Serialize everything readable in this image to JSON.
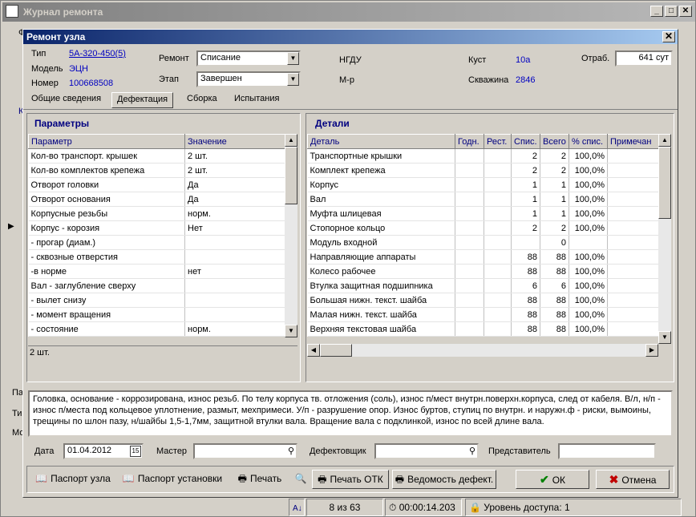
{
  "app": {
    "title": "Журнал ремонта",
    "left_fragments": [
      "Ф",
      "К",
      "Па",
      "Ти",
      "Мо"
    ]
  },
  "dialog": {
    "title": "Ремонт узла",
    "close": "✕",
    "header": {
      "type_label": "Тип",
      "type_value": "5А-320-450(5)",
      "model_label": "Модель",
      "model_value": "ЭЦН",
      "number_label": "Номер",
      "number_value": "100668508",
      "repair_label": "Ремонт",
      "repair_value": "Списание",
      "stage_label": "Этап",
      "stage_value": "Завершен",
      "ngdu_label": "НГДУ",
      "mr_label": "М-р",
      "kust_label": "Куст",
      "kust_value": "10а",
      "well_label": "Скважина",
      "well_value": "2846",
      "otrab_label": "Отраб.",
      "otrab_value": "641 сут"
    },
    "tabs": [
      "Общие сведения",
      "Дефектация",
      "Сборка",
      "Испытания"
    ],
    "params": {
      "title": "Параметры",
      "columns": [
        "Параметр",
        "Значение"
      ],
      "rows": [
        [
          "Кол-во транспорт. крышек",
          "2 шт."
        ],
        [
          "Кол-во комплектов крепежа",
          "2 шт."
        ],
        [
          "Отворот головки",
          "Да"
        ],
        [
          "Отворот основания",
          "Да"
        ],
        [
          "Корпусные резьбы",
          "норм."
        ],
        [
          "Корпус - корозия",
          "Нет"
        ],
        [
          "             - прогар (диам.)",
          ""
        ],
        [
          "             - сквозные отверстия",
          ""
        ],
        [
          "             -в норме",
          "нет"
        ],
        [
          "Вал     - заглубление сверху",
          ""
        ],
        [
          "             - вылет снизу",
          ""
        ],
        [
          "             - момент вращения",
          ""
        ],
        [
          "             - состояние",
          "норм."
        ]
      ],
      "footer": "2 шт."
    },
    "details": {
      "title": "Детали",
      "columns": [
        "Деталь",
        "Годн.",
        "Рест.",
        "Спис.",
        "Всего",
        "% спис.",
        "Примечан"
      ],
      "rows": [
        [
          "Транспортные крышки",
          "",
          "",
          "2",
          "2",
          "100,0%",
          ""
        ],
        [
          "Комплект крепежа",
          "",
          "",
          "2",
          "2",
          "100,0%",
          ""
        ],
        [
          "Корпус",
          "",
          "",
          "1",
          "1",
          "100,0%",
          ""
        ],
        [
          "Вал",
          "",
          "",
          "1",
          "1",
          "100,0%",
          ""
        ],
        [
          "Муфта шлицевая",
          "",
          "",
          "1",
          "1",
          "100,0%",
          ""
        ],
        [
          "Стопорное кольцо",
          "",
          "",
          "2",
          "2",
          "100,0%",
          ""
        ],
        [
          "Модуль входной",
          "",
          "",
          "",
          "0",
          "",
          ""
        ],
        [
          "Направляющие аппараты",
          "",
          "",
          "88",
          "88",
          "100,0%",
          ""
        ],
        [
          "Колесо рабочее",
          "",
          "",
          "88",
          "88",
          "100,0%",
          ""
        ],
        [
          "Втулка защитная подшипника",
          "",
          "",
          "6",
          "6",
          "100,0%",
          ""
        ],
        [
          "Большая нижн. текст. шайба",
          "",
          "",
          "88",
          "88",
          "100,0%",
          ""
        ],
        [
          "Малая нижн. текст. шайба",
          "",
          "",
          "88",
          "88",
          "100,0%",
          ""
        ],
        [
          "Верхняя текстовая шайба",
          "",
          "",
          "88",
          "88",
          "100,0%",
          ""
        ]
      ]
    },
    "notes": "Головка, основание - коррозирована, износ резьб. По телу корпуса тв. отложения (соль), износ п/мест внутрн.поверхн.корпуса, след от кабеля. В/л, н/п - износ п/места под кольцевое уплотнение, размыт, мехпримеси. У/п - разрушение опор. Износ буртов, ступиц по внутрн. и наружн.ф - риски, вымоины, трещины по шлон пазу, н/шайбы 1,5-1,7мм, защитной втулки вала. Вращение вала с подклинкой, износ по всей длине вала.",
    "bottom": {
      "date_label": "Дата",
      "date_value": "01.04.2012",
      "master_label": "Мастер",
      "master_value": "",
      "defect_label": "Дефектовщик",
      "defect_value": "",
      "rep_label": "Представитель",
      "rep_value": ""
    },
    "buttons": {
      "passport_node": "Паспорт узла",
      "passport_install": "Паспорт установки",
      "print": "Печать",
      "print_otk": "Печать ОТК",
      "defect_list": "Ведомость дефект.",
      "ok": "ОК",
      "cancel": "Отмена"
    }
  },
  "statusbar": {
    "records": "8 из 63",
    "time": "00:00:14.203",
    "access": "Уровень доступа: 1"
  },
  "colors": {
    "title_blue": "#0a246a",
    "link": "#0000c0",
    "face": "#d4d0c8",
    "ok_green": "#008000",
    "cancel_red": "#c00000"
  }
}
